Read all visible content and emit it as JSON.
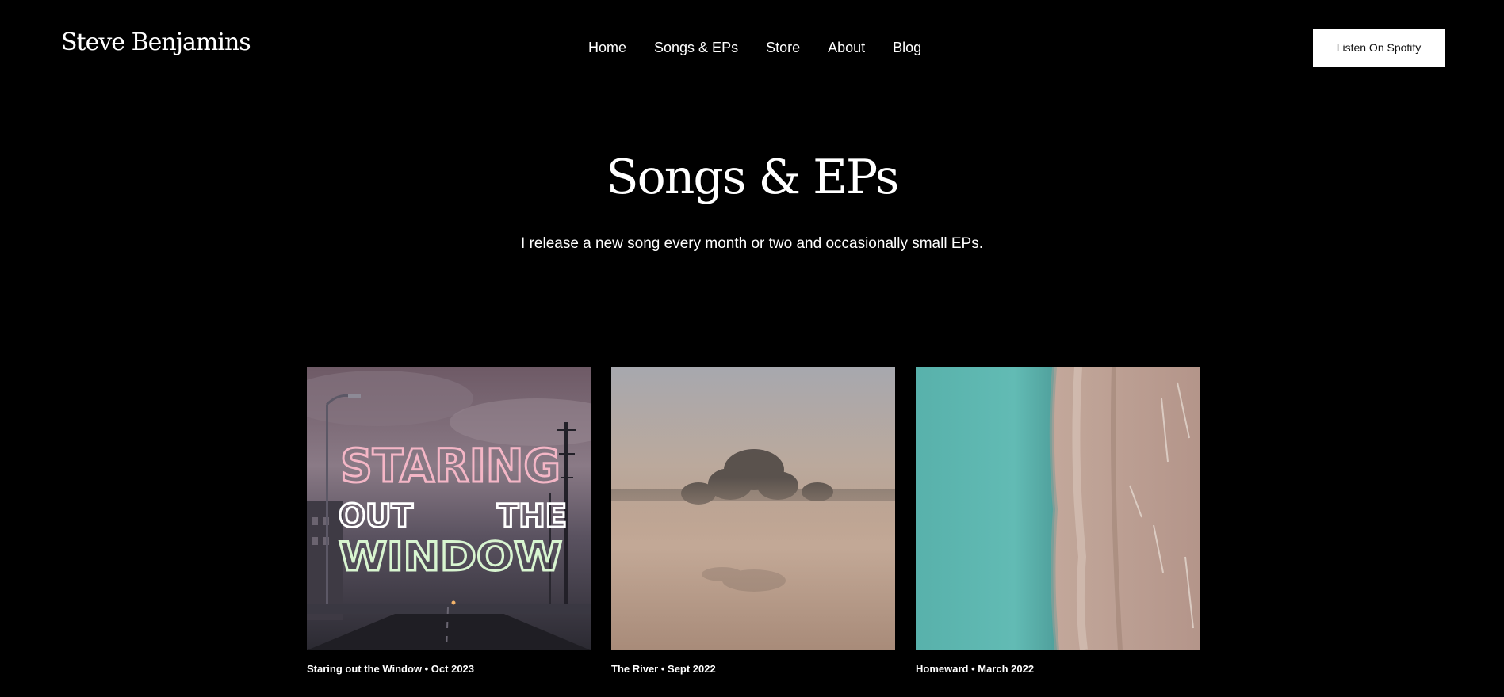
{
  "header": {
    "logo": "Steve Benjamins",
    "nav": [
      {
        "label": "Home",
        "active": false
      },
      {
        "label": "Songs & EPs",
        "active": true
      },
      {
        "label": "Store",
        "active": false
      },
      {
        "label": "About",
        "active": false
      },
      {
        "label": "Blog",
        "active": false
      }
    ],
    "cta_label": "Listen On Spotify"
  },
  "hero": {
    "title": "Songs & EPs",
    "subtitle": "I release a new song every month or two and occasionally small EPs."
  },
  "releases": [
    {
      "caption": "Staring out the Window • Oct 2023",
      "cover_text": [
        "STARING",
        "OUT",
        "THE",
        "WINDOW"
      ]
    },
    {
      "caption": "The River • Sept 2022"
    },
    {
      "caption": "Homeward • March 2022"
    }
  ],
  "colors": {
    "background": "#000000",
    "text": "#ffffff",
    "button_bg": "#ffffff",
    "button_text": "#111111",
    "cover_title_pink": "#f4b6c6",
    "cover_title_mint": "#d8f5d0",
    "water": "#5fb7b0",
    "sand": "#b9998a"
  }
}
